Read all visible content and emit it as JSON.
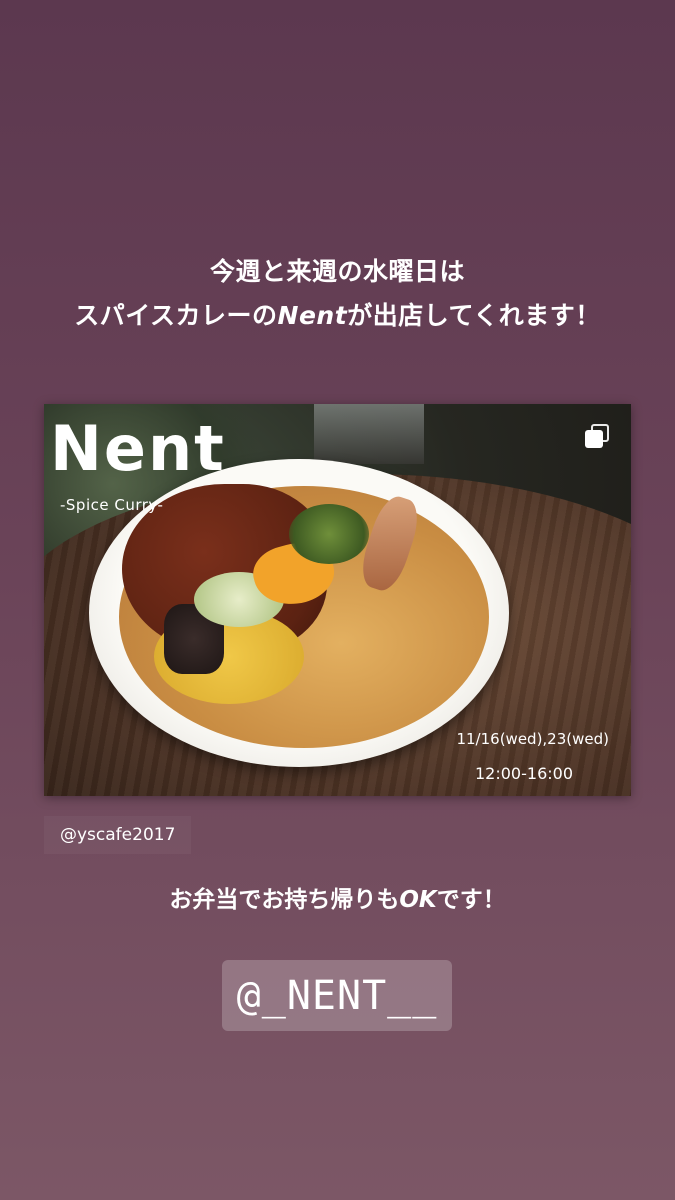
{
  "headline": {
    "line1": "今週と来週の水曜日は",
    "line2_before": "スパイスカレーの",
    "line2_brand": "Nent",
    "line2_after": "が出店してくれます！"
  },
  "post": {
    "title": "Nent",
    "subtitle": "-Spice Curry-",
    "dates": "11/16(wed),23(wed)",
    "time": "12:00-16:00",
    "icon": "multi-image-icon"
  },
  "username": "@yscafe2017",
  "takeout": {
    "before": "お弁当でお持ち帰りも",
    "ok": "OK",
    "after": "です！"
  },
  "mention": {
    "at": "@",
    "handle": "_NENT__"
  },
  "colors": {
    "background_top": "#5c384f",
    "background_bottom": "#7c5766",
    "text": "#ffffff"
  }
}
